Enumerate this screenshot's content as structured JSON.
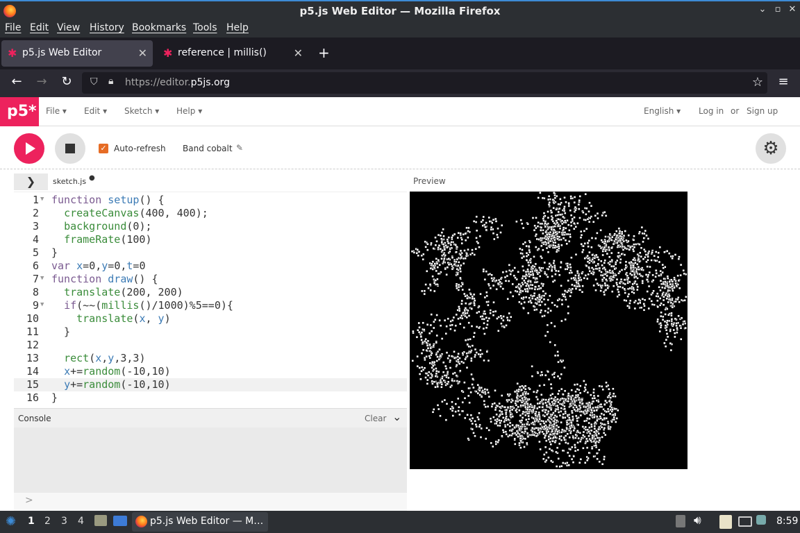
{
  "window": {
    "title": "p5.js Web Editor — Mozilla Firefox"
  },
  "menubar": {
    "items": [
      "File",
      "Edit",
      "View",
      "History",
      "Bookmarks",
      "Tools",
      "Help"
    ]
  },
  "tabs": [
    {
      "label": "p5.js Web Editor",
      "active": true
    },
    {
      "label": "reference | millis()",
      "active": false
    }
  ],
  "urlbar": {
    "prefix": "https://editor.",
    "domain": "p5js.org"
  },
  "p5": {
    "logo": "p5*",
    "menus": [
      "File",
      "Edit",
      "Sketch",
      "Help"
    ],
    "language": "English",
    "login": "Log in",
    "or": "or",
    "signup": "Sign up",
    "auto_refresh_label": "Auto-refresh",
    "auto_refresh_checked": true,
    "sketch_name": "Band cobalt",
    "file_name": "sketch.js",
    "preview_label": "Preview",
    "console_label": "Console",
    "clear_label": "Clear",
    "console_prompt": ">"
  },
  "code_lines": [
    "function setup() {",
    "  createCanvas(400, 400);",
    "  background(0);",
    "  frameRate(100)",
    "}",
    "var x=0,y=0,t=0",
    "function draw() {",
    "  translate(200, 200)",
    "  if(~~(millis()/1000)%5==0){",
    "    translate(x, y)",
    "  }",
    "",
    "  rect(x,y,3,3)",
    "  x+=random(-10,10)",
    "  y+=random(-10,10)",
    "}"
  ],
  "current_line": 15,
  "folded_lines": [
    1,
    7,
    9
  ],
  "taskbar": {
    "workspaces": [
      "1",
      "2",
      "3",
      "4"
    ],
    "active_workspace": "1",
    "app_label": "p5.js Web Editor — M…",
    "clock": "8:59"
  },
  "colors": {
    "accent": "#ed225d",
    "checkbox": "#e66c25"
  }
}
